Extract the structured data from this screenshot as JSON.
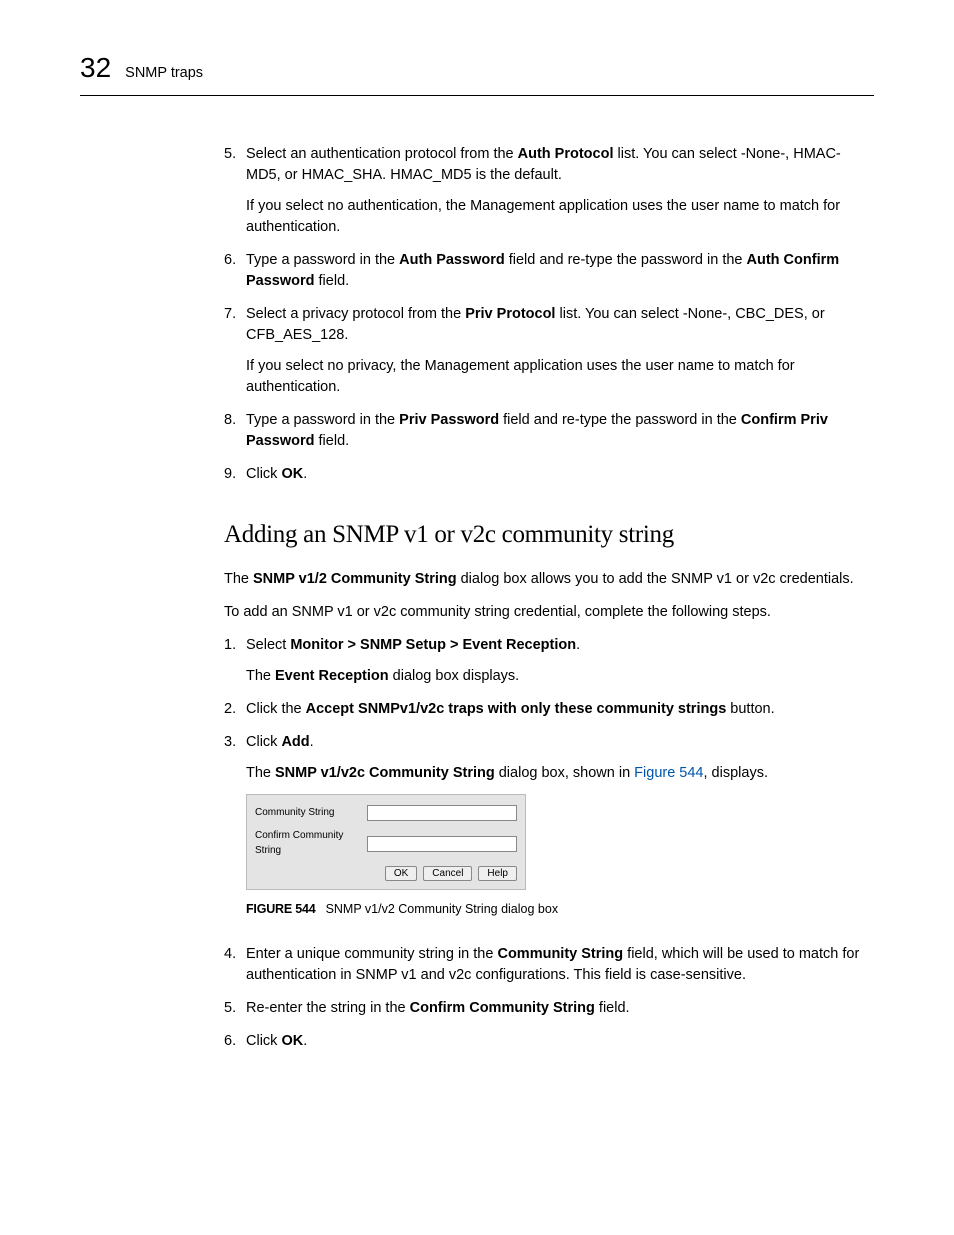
{
  "header": {
    "chapterNumber": "32",
    "title": "SNMP traps"
  },
  "stepsA": [
    {
      "num": "5.",
      "paras": [
        [
          {
            "t": "Select an authentication protocol from the "
          },
          {
            "t": "Auth Protocol",
            "b": true
          },
          {
            "t": " list. You can select -None-, HMAC-MD5, or HMAC_SHA. HMAC_MD5 is the default."
          }
        ],
        [
          {
            "t": "If you select no authentication, the Management application uses the user name to match for authentication."
          }
        ]
      ]
    },
    {
      "num": "6.",
      "paras": [
        [
          {
            "t": "Type a password in the "
          },
          {
            "t": "Auth Password",
            "b": true
          },
          {
            "t": " field and re-type the password in the "
          },
          {
            "t": "Auth Confirm Password",
            "b": true
          },
          {
            "t": " field."
          }
        ]
      ]
    },
    {
      "num": "7.",
      "paras": [
        [
          {
            "t": "Select a privacy protocol from the "
          },
          {
            "t": "Priv Protocol",
            "b": true
          },
          {
            "t": " list. You can select -None-, CBC_DES, or CFB_AES_128."
          }
        ],
        [
          {
            "t": "If you select no privacy, the Management application uses the user name to match for authentication."
          }
        ]
      ]
    },
    {
      "num": "8.",
      "paras": [
        [
          {
            "t": "Type a password in the "
          },
          {
            "t": "Priv Password",
            "b": true
          },
          {
            "t": " field and re-type the password in the "
          },
          {
            "t": "Confirm Priv Password",
            "b": true
          },
          {
            "t": " field."
          }
        ]
      ]
    },
    {
      "num": "9.",
      "paras": [
        [
          {
            "t": "Click "
          },
          {
            "t": "OK",
            "b": true
          },
          {
            "t": "."
          }
        ]
      ]
    }
  ],
  "sectionTitle": "Adding an SNMP v1 or v2c community string",
  "introParas": [
    [
      {
        "t": "The "
      },
      {
        "t": "SNMP v1/2 Community String",
        "b": true
      },
      {
        "t": " dialog box allows you to add the SNMP v1 or v2c credentials."
      }
    ],
    [
      {
        "t": "To add an SNMP v1 or v2c community string credential, complete the following steps."
      }
    ]
  ],
  "stepsB": [
    {
      "num": "1.",
      "paras": [
        [
          {
            "t": "Select "
          },
          {
            "t": "Monitor > SNMP Setup > Event Reception",
            "b": true
          },
          {
            "t": "."
          }
        ],
        [
          {
            "t": "The "
          },
          {
            "t": "Event Reception",
            "b": true
          },
          {
            "t": " dialog box displays."
          }
        ]
      ]
    },
    {
      "num": "2.",
      "paras": [
        [
          {
            "t": "Click the "
          },
          {
            "t": "Accept SNMPv1/v2c traps with only these community strings",
            "b": true
          },
          {
            "t": " button."
          }
        ]
      ]
    },
    {
      "num": "3.",
      "paras": [
        [
          {
            "t": "Click "
          },
          {
            "t": "Add",
            "b": true
          },
          {
            "t": "."
          }
        ],
        [
          {
            "t": "The "
          },
          {
            "t": "SNMP v1/v2c Community String",
            "b": true
          },
          {
            "t": " dialog box, shown in "
          },
          {
            "t": "Figure 544",
            "link": true
          },
          {
            "t": ", displays."
          }
        ]
      ],
      "figureAfter": true
    },
    {
      "num": "4.",
      "paras": [
        [
          {
            "t": "Enter a unique community string in the "
          },
          {
            "t": "Community String",
            "b": true
          },
          {
            "t": " field, which will be used to match for authentication in SNMP v1 and v2c configurations. This field is case-sensitive."
          }
        ]
      ]
    },
    {
      "num": "5.",
      "paras": [
        [
          {
            "t": "Re-enter the string in the "
          },
          {
            "t": "Confirm Community String",
            "b": true
          },
          {
            "t": " field."
          }
        ]
      ]
    },
    {
      "num": "6.",
      "paras": [
        [
          {
            "t": "Click "
          },
          {
            "t": "OK",
            "b": true
          },
          {
            "t": "."
          }
        ]
      ]
    }
  ],
  "dialog": {
    "label1": "Community String",
    "label2": "Confirm Community String",
    "ok": "OK",
    "cancel": "Cancel",
    "help": "Help"
  },
  "figure": {
    "num": "FIGURE 544",
    "caption": "SNMP v1/v2 Community String dialog box"
  }
}
